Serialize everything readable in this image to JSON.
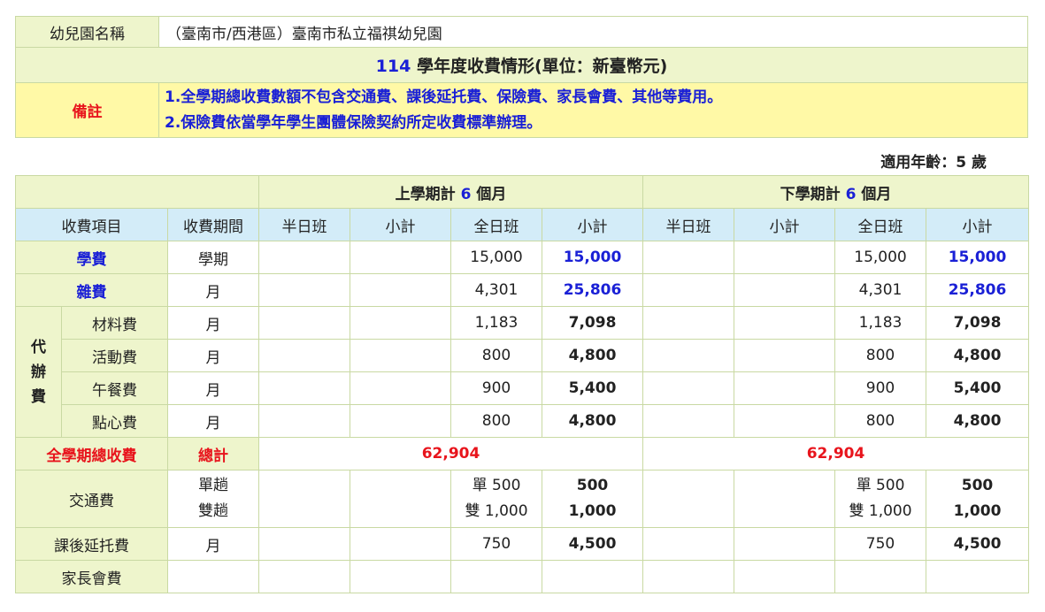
{
  "info": {
    "name_label": "幼兒園名稱",
    "name_value": "（臺南市/西港區）臺南市私立福祺幼兒園",
    "year": "114",
    "title_rest": " 學年度收費情形(單位：新臺幣元)",
    "remark_label": "備註",
    "remark_1": "1.全學期總收費數額不包含交通費、課後延托費、保險費、家長會費、其他等費用。",
    "remark_2": "2.保險費依當學年學生團體保險契約所定收費標準辦理。"
  },
  "age": "適用年齡：5 歲",
  "semesters": {
    "first_pre": "上學期計 ",
    "first_num": "6",
    "first_post": " 個月",
    "second_pre": "下學期計 ",
    "second_num": "6",
    "second_post": " 個月"
  },
  "headers": {
    "item": "收費項目",
    "period": "收費期間",
    "half": "半日班",
    "subtotal": "小計",
    "full": "全日班"
  },
  "rows": {
    "tuition": {
      "label": "學費",
      "period": "學期",
      "full": "15,000",
      "sub": "15,000"
    },
    "misc": {
      "label": "雜費",
      "period": "月",
      "full": "4,301",
      "sub": "25,806"
    },
    "agent_label": [
      "代",
      "辦",
      "費"
    ],
    "material": {
      "label": "材料費",
      "period": "月",
      "full": "1,183",
      "sub": "7,098"
    },
    "activity": {
      "label": "活動費",
      "period": "月",
      "full": "800",
      "sub": "4,800"
    },
    "lunch": {
      "label": "午餐費",
      "period": "月",
      "full": "900",
      "sub": "5,400"
    },
    "snack": {
      "label": "點心費",
      "period": "月",
      "full": "800",
      "sub": "4,800"
    },
    "total": {
      "label": "全學期總收費",
      "period": "總計",
      "value": "62,904"
    },
    "transport": {
      "label": "交通費",
      "period_1": "單趟",
      "period_2": "雙趟",
      "full_1": "單 500",
      "full_2": "雙 1,000",
      "sub_1": "500",
      "sub_2": "1,000"
    },
    "afterschool": {
      "label": "課後延托費",
      "period": "月",
      "full": "750",
      "sub": "4,500"
    },
    "parent": {
      "label": "家長會費"
    }
  },
  "colors": {
    "green": "#eef5cc",
    "blue_header": "#d3ecf8",
    "yellow": "#fff9a6",
    "red": "#e8141c",
    "blue": "#1a20d6",
    "border": "#c9d9a3"
  }
}
